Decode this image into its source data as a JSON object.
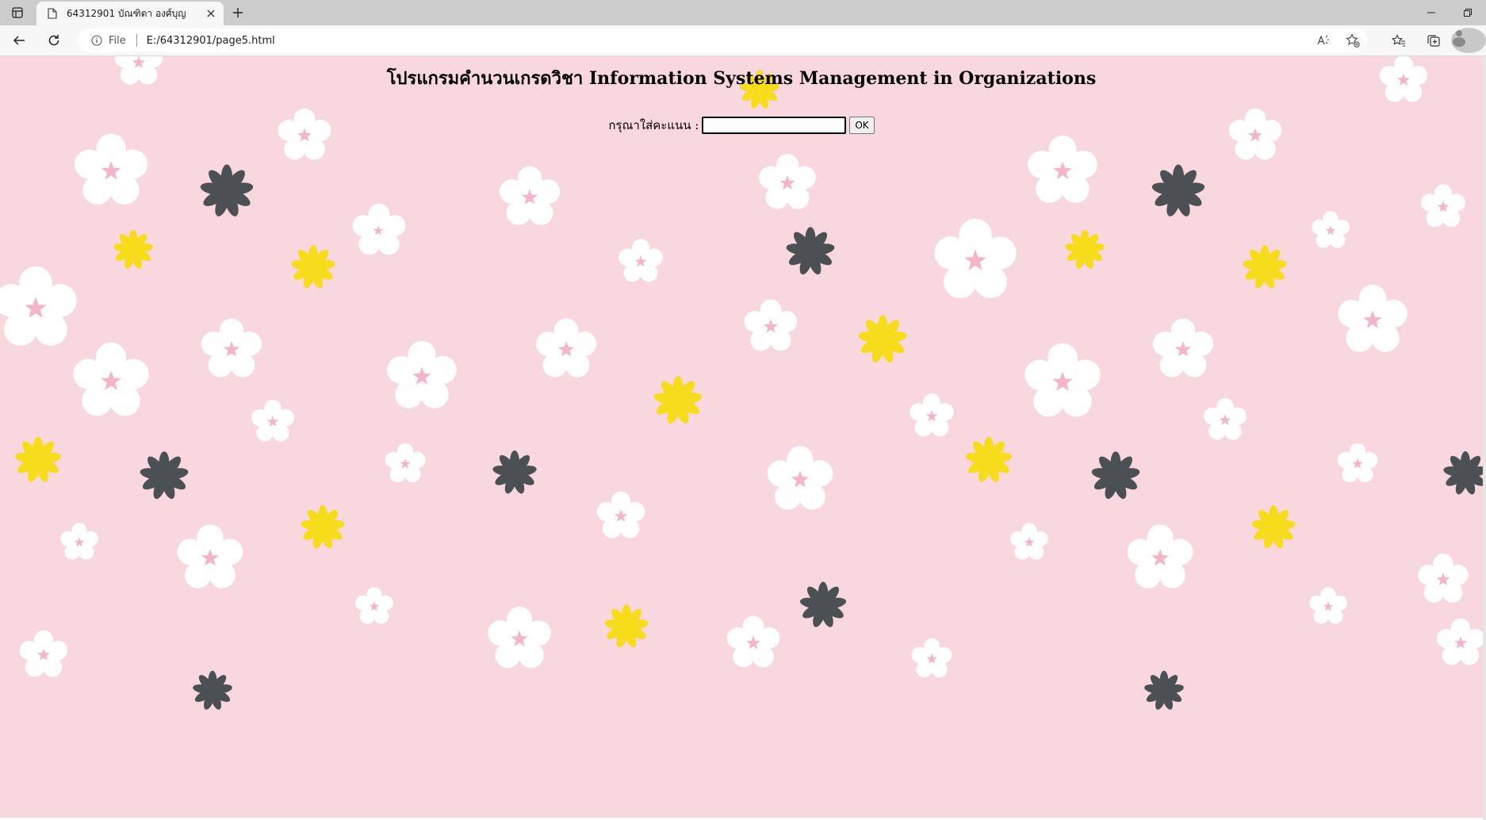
{
  "browser": {
    "tab_title": "64312901 บัณฑิตา องศ์บุญ",
    "address_scheme": "File",
    "address_url": "E:/64312901/page5.html"
  },
  "page": {
    "title": "โปรแกรมคำนวนเกรดวิชา Information Systems Management in Organizations",
    "score_label": "กรุณาใส่คะแนน :",
    "score_value": "",
    "ok_label": "OK"
  },
  "colors": {
    "background": "#f9d7de",
    "flower_white": "#ffffff",
    "flower_yellow": "#f7dc1c",
    "flower_dark": "#4a5054"
  },
  "icons": [
    "sidebar-icon",
    "document-icon",
    "close-icon",
    "plus-icon",
    "minimize-icon",
    "restore-icon",
    "back-icon",
    "refresh-icon",
    "info-icon",
    "read-aloud-icon",
    "add-favorite-icon",
    "favorites-icon",
    "collections-icon",
    "profile-icon"
  ]
}
